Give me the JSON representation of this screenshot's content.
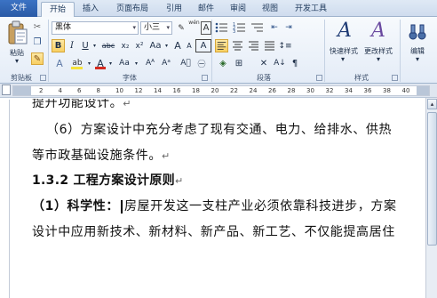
{
  "tabs": {
    "file": "文件",
    "items": [
      "开始",
      "插入",
      "页面布局",
      "引用",
      "邮件",
      "审阅",
      "视图",
      "开发工具"
    ]
  },
  "ribbon": {
    "clipboard": {
      "paste_label": "粘贴",
      "group_label": "剪贴板"
    },
    "font": {
      "font_name": "黑体",
      "font_size": "小三",
      "size_grow": "A",
      "size_shrink": "A",
      "wen": "wén",
      "bold": "B",
      "italic": "I",
      "underline": "U",
      "strike": "abc",
      "subscript": "x₂",
      "superscript": "x²",
      "font_color": "A",
      "char_shade": "Aa",
      "char_border": "A",
      "char_border2": "A",
      "group_label": "字体"
    },
    "paragraph": {
      "group_label": "段落"
    },
    "styles": {
      "quick_styles": "快速样式",
      "change_styles": "更改样式",
      "group_label": "样式"
    },
    "editing": {
      "label": "编辑"
    }
  },
  "ruler": {
    "numbers": [
      "2",
      "4",
      "6",
      "8",
      "10",
      "12",
      "14",
      "16",
      "18",
      "20",
      "22",
      "24",
      "26",
      "28",
      "30",
      "32",
      "34",
      "36",
      "38",
      "40"
    ]
  },
  "document": {
    "lines": [
      {
        "text": "提升功能设计。",
        "mark": "↵"
      },
      {
        "text": "（6）方案设计中充分考虑了现有交通、电力、给排水、供热",
        "mark": ""
      },
      {
        "text": "等市政基础设施条件。",
        "mark": "↵"
      },
      {
        "text": "1.3.2 工程方案设计原则",
        "mark": "↵"
      },
      {
        "text_before": "（1）科学性：",
        "text_after": "房屋开发这一支柱产业必须依靠科技进步，方案"
      },
      {
        "text": "设计中应用新技术、新材料、新产品、新工艺、不仅能提高居住",
        "mark": ""
      }
    ]
  },
  "colors": {
    "file_tab": "#2a5aa6",
    "highlight": "#f8cf62",
    "font_color_bar": "#d42a1f",
    "highlight_bar": "#f6e23a"
  }
}
